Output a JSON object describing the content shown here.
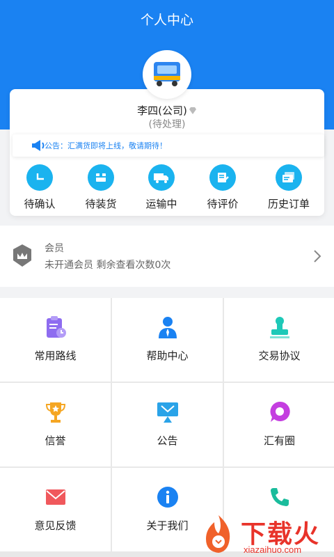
{
  "header": {
    "title": "个人中心"
  },
  "profile": {
    "name": "李四(公司)",
    "status": "(待处理)"
  },
  "notice": {
    "text": "公告：汇满货即将上线，敬请期待！"
  },
  "orders": [
    {
      "label": "待确认",
      "icon": "pending-confirm-icon"
    },
    {
      "label": "待装货",
      "icon": "pending-load-icon"
    },
    {
      "label": "运输中",
      "icon": "in-transit-truck-icon"
    },
    {
      "label": "待评价",
      "icon": "pending-review-icon"
    },
    {
      "label": "历史订单",
      "icon": "order-history-icon"
    }
  ],
  "member": {
    "title": "会员",
    "desc": "未开通会员 剩余查看次数0次"
  },
  "grid": [
    {
      "label": "常用路线",
      "icon": "route-clipboard-icon",
      "color": "#8e6cf0"
    },
    {
      "label": "帮助中心",
      "icon": "help-person-icon",
      "color": "#1a82f2"
    },
    {
      "label": "交易协议",
      "icon": "stamp-icon",
      "color": "#1ec9b8"
    },
    {
      "label": "信誉",
      "icon": "trophy-icon",
      "color": "#f5a623"
    },
    {
      "label": "公告",
      "icon": "announcement-board-icon",
      "color": "#2aa3e8"
    },
    {
      "label": "汇有圈",
      "icon": "chat-bubble-icon",
      "color": "#c43ee0"
    },
    {
      "label": "意见反馈",
      "icon": "mail-icon",
      "color": "#f0585c"
    },
    {
      "label": "关于我们",
      "icon": "info-icon",
      "color": "#1a82f2"
    },
    {
      "label": "",
      "icon": "phone-icon",
      "color": "#1abc9c"
    }
  ],
  "watermark": {
    "text": "下载火",
    "url": "xiazaihuo.com"
  },
  "colors": {
    "primary": "#1a82f2",
    "order_icon_bg": "#1ab3ef"
  }
}
